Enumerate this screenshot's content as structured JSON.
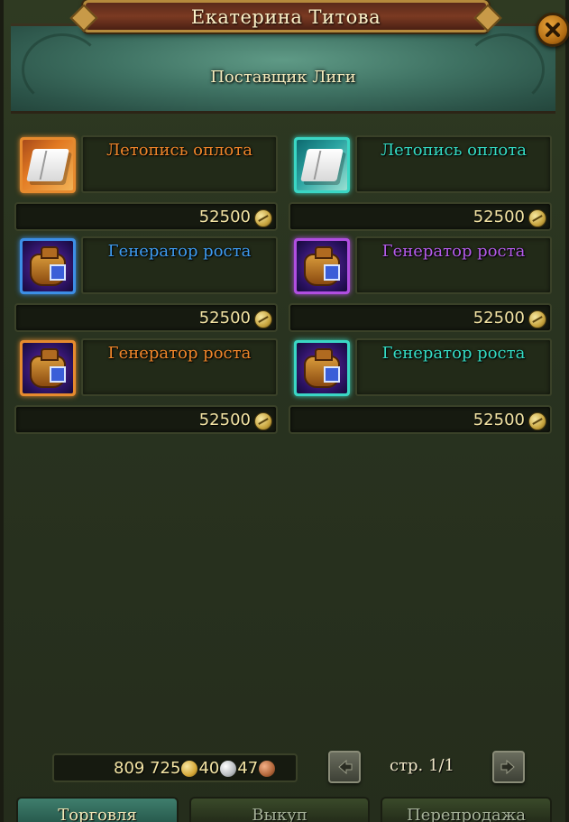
{
  "window": {
    "npc_name": "Екатерина Титова",
    "npc_role": "Поставщик Лиги",
    "close_icon": "close-icon"
  },
  "items": [
    {
      "name": "Летопись оплота",
      "price": "52500",
      "name_color": "#f0862a",
      "frame_color": "#e68a2e",
      "icon": "book-icon",
      "variant": "orange"
    },
    {
      "name": "Летопись оплота",
      "price": "52500",
      "name_color": "#34dcc4",
      "frame_color": "#3ad6c4",
      "icon": "book-icon",
      "variant": "teal"
    },
    {
      "name": "Генератор роста",
      "price": "52500",
      "name_color": "#3e9bf0",
      "frame_color": "#3c8ee6",
      "icon": "generator-icon",
      "variant": "blue"
    },
    {
      "name": "Генератор роста",
      "price": "52500",
      "name_color": "#b45bea",
      "frame_color": "#b04ee0",
      "icon": "generator-icon",
      "variant": "purple"
    },
    {
      "name": "Генератор роста",
      "price": "52500",
      "name_color": "#f0862a",
      "frame_color": "#e68a2e",
      "icon": "generator-icon",
      "variant": "orange"
    },
    {
      "name": "Генератор роста",
      "price": "52500",
      "name_color": "#34dcc4",
      "frame_color": "#3ad6c4",
      "icon": "generator-icon",
      "variant": "teal"
    }
  ],
  "wallet": {
    "gold": "809 725",
    "silver": "40",
    "copper": "47"
  },
  "pagination": {
    "label": "стр. 1/1"
  },
  "tabs": [
    {
      "label": "Торговля",
      "active": true
    },
    {
      "label": "Выкуп",
      "active": false
    },
    {
      "label": "Перепродажа",
      "active": false
    }
  ]
}
